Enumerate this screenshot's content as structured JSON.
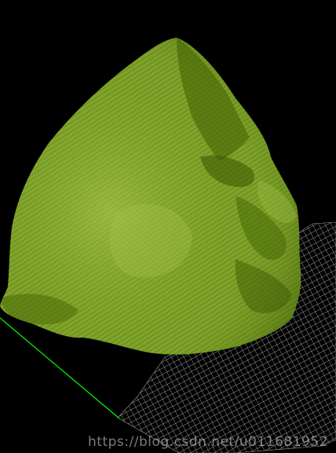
{
  "viewer": {
    "background_color": "#000000",
    "mesh_color": "#7fa32a",
    "mesh_shadow_color": "#3f5f00",
    "mesh_highlight_color": "#a6c24a",
    "ground_grid_color": "#cfcfcf",
    "axis_color": "#00ff00"
  },
  "watermark": {
    "text": "https://blog.csdn.net/u011681952"
  }
}
